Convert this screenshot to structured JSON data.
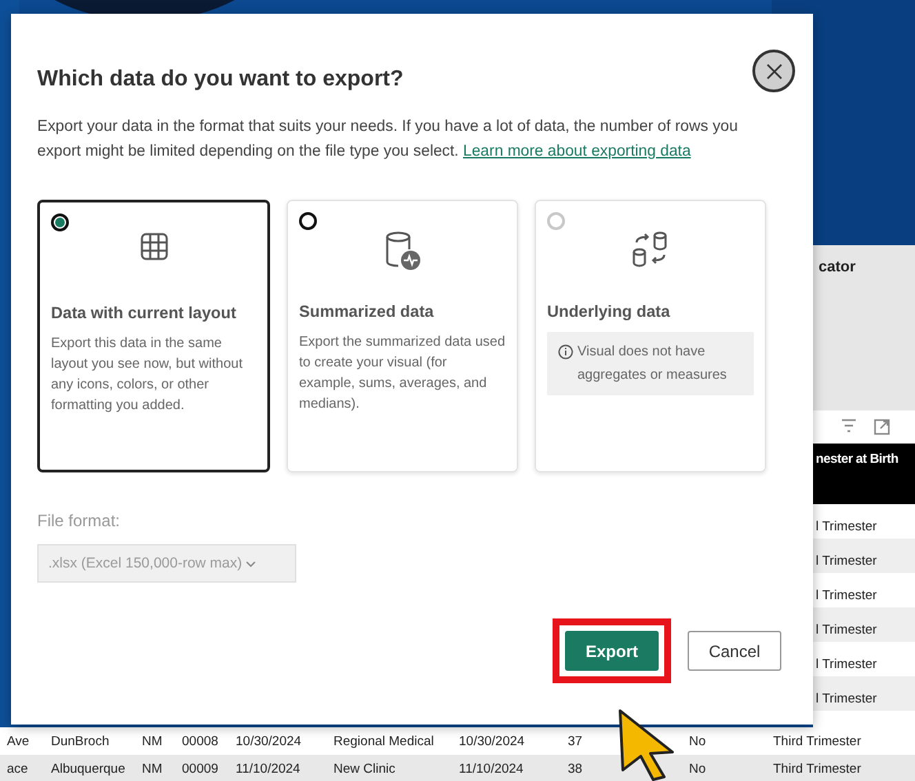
{
  "dialog": {
    "title": "Which data do you want to export?",
    "description": "Export your data in the format that suits your needs. If you have a lot of data, the number of rows you export might be limited depending on the file type you select.",
    "link": "Learn more about exporting data",
    "options": [
      {
        "kind": "layout",
        "title": "Data with current layout",
        "description": "Export this data in the same layout you see now, but without any icons, colors, or other formatting you added.",
        "selected": true,
        "disabled": false
      },
      {
        "kind": "summarized",
        "title": "Summarized data",
        "description": "Export the summarized data used to create your visual (for example, sums, averages, and medians).",
        "selected": false,
        "disabled": false
      },
      {
        "kind": "underlying",
        "title": "Underlying data",
        "note": "Visual does not have aggregates or measures",
        "selected": false,
        "disabled": true
      }
    ],
    "file_format": {
      "label": "File format:",
      "value": ".xlsx (Excel 150,000-row max)",
      "disabled": true
    },
    "buttons": [
      {
        "label": "Export",
        "kind": "primary",
        "highlighted": true
      },
      {
        "label": "Cancel",
        "kind": "secondary",
        "highlighted": false
      }
    ]
  },
  "report": {
    "title": "cator",
    "column_header": "nester at Birth",
    "rows": [
      "l Trimester",
      "l Trimester",
      "l Trimester",
      "l Trimester",
      "l Trimester",
      "l Trimester"
    ]
  },
  "table": {
    "rows": [
      [
        "Ave",
        "DunBroch",
        "NM",
        "00008",
        "10/30/2024",
        "Regional Medical",
        "10/30/2024",
        "37",
        "No",
        "Third Trimester"
      ],
      [
        "ace",
        "Albuquerque",
        "NM",
        "00009",
        "11/10/2024",
        "New Clinic",
        "11/10/2024",
        "38",
        "No",
        "Third Trimester"
      ]
    ]
  }
}
